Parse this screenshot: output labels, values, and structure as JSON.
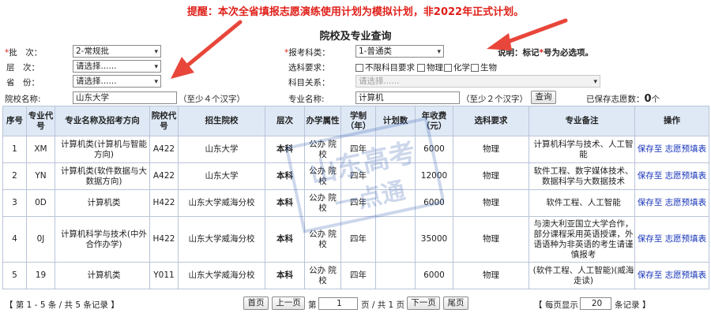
{
  "notice": "提醒：本次全省填报志愿演练使用计划为模拟计划，非2022年正式计划。",
  "page_title": "院校及专业查询",
  "form": {
    "batch_label": "批　次：",
    "batch_value": "2-常规批",
    "level_label": "层　次：",
    "level_value": "请选择......",
    "province_label": "省　份：",
    "province_value": "请选择......",
    "school_label": "院校名称:",
    "school_value": "山东大学",
    "school_hint": "（至少４个汉字）",
    "category_label": "报考科类：",
    "category_value": "1-普通类",
    "subject_req_label": "选科要求：",
    "subject_options": [
      "不限科目要求",
      "物理",
      "化学",
      "生物"
    ],
    "subject_relation_label": "科目关系：",
    "subject_relation_value": "请选择......",
    "major_label": "专业名称:",
    "major_value": "计算机",
    "major_hint": "（至少２个汉字）",
    "query_button": "查询",
    "explanation_prefix": "说明：标记",
    "explanation_star": "*",
    "explanation_suffix": "号为必选项。",
    "saved_label": "已保存志愿数：",
    "saved_count": "0",
    "saved_unit": "个"
  },
  "table": {
    "headers": [
      "序号",
      "专业代号",
      "专业名称及招考方向",
      "院校代号",
      "招生院校",
      "层次",
      "办学属性",
      "学制（年）",
      "计划数",
      "年收费（元）",
      "选科要求",
      "专业备注",
      "操作"
    ],
    "rows": [
      {
        "no": "1",
        "code": "XM",
        "major": "计算机类(计算机与智能方向)",
        "school_code": "A422",
        "school": "山东大学",
        "level": "本科",
        "attr": "公办 院校",
        "years": "四年",
        "plan": "",
        "fee": "6000",
        "req": "物理",
        "remark": "计算机科学与技术、人工智能",
        "action": "保存至 志愿预填表"
      },
      {
        "no": "2",
        "code": "YN",
        "major": "计算机类(软件数据与大数据方向)",
        "school_code": "A422",
        "school": "山东大学",
        "level": "本科",
        "attr": "公办 院校",
        "years": "四年",
        "plan": "",
        "fee": "12000",
        "req": "物理",
        "remark": "软件工程、数字媒体技术、数据科学与大数据技术",
        "action": "保存至 志愿预填表"
      },
      {
        "no": "3",
        "code": "0D",
        "major": "计算机类",
        "school_code": "H422",
        "school": "山东大学威海分校",
        "level": "本科",
        "attr": "公办 院校",
        "years": "四年",
        "plan": "",
        "fee": "6000",
        "req": "物理",
        "remark": "软件工程、人工智能",
        "action": "保存至 志愿预填表"
      },
      {
        "no": "4",
        "code": "0J",
        "major": "计算机科学与技术(中外合作办学)",
        "school_code": "H422",
        "school": "山东大学威海分校",
        "level": "本科",
        "attr": "公办 院校",
        "years": "四年",
        "plan": "",
        "fee": "35000",
        "req": "物理",
        "remark": "与澳大利亚国立大学合作，部分课程采用英语授课，外语语种为非英语的考生请谨慎报考",
        "action": "保存至 志愿预填表"
      },
      {
        "no": "5",
        "code": "19",
        "major": "计算机类",
        "school_code": "Y011",
        "school": "山东大学威海分校",
        "level": "本科",
        "attr": "公办 院校",
        "years": "四年",
        "plan": "",
        "fee": "6000",
        "req": "物理",
        "remark": "(软件工程、人工智能)(威海走读)",
        "action": "保存至 志愿预填表"
      }
    ]
  },
  "footer": {
    "record_info": "【 第 1 - 5 条 / 共 5 条记录 】",
    "first": "首页",
    "prev": "上一页",
    "page_prefix": "第",
    "page_value": "1",
    "page_suffix": "页 / 共 1 页",
    "next": "下一页",
    "last": "尾页",
    "per_page_prefix": "【 每页显示",
    "per_page_value": "20",
    "per_page_suffix": "条记录 】"
  },
  "watermark": {
    "line1": "山东高考",
    "line2": "一点通"
  },
  "colors": {
    "notice": "#e0201a",
    "header_bg": "#dfe9f6",
    "link": "#1633b8",
    "arrow": "#e8463a"
  }
}
